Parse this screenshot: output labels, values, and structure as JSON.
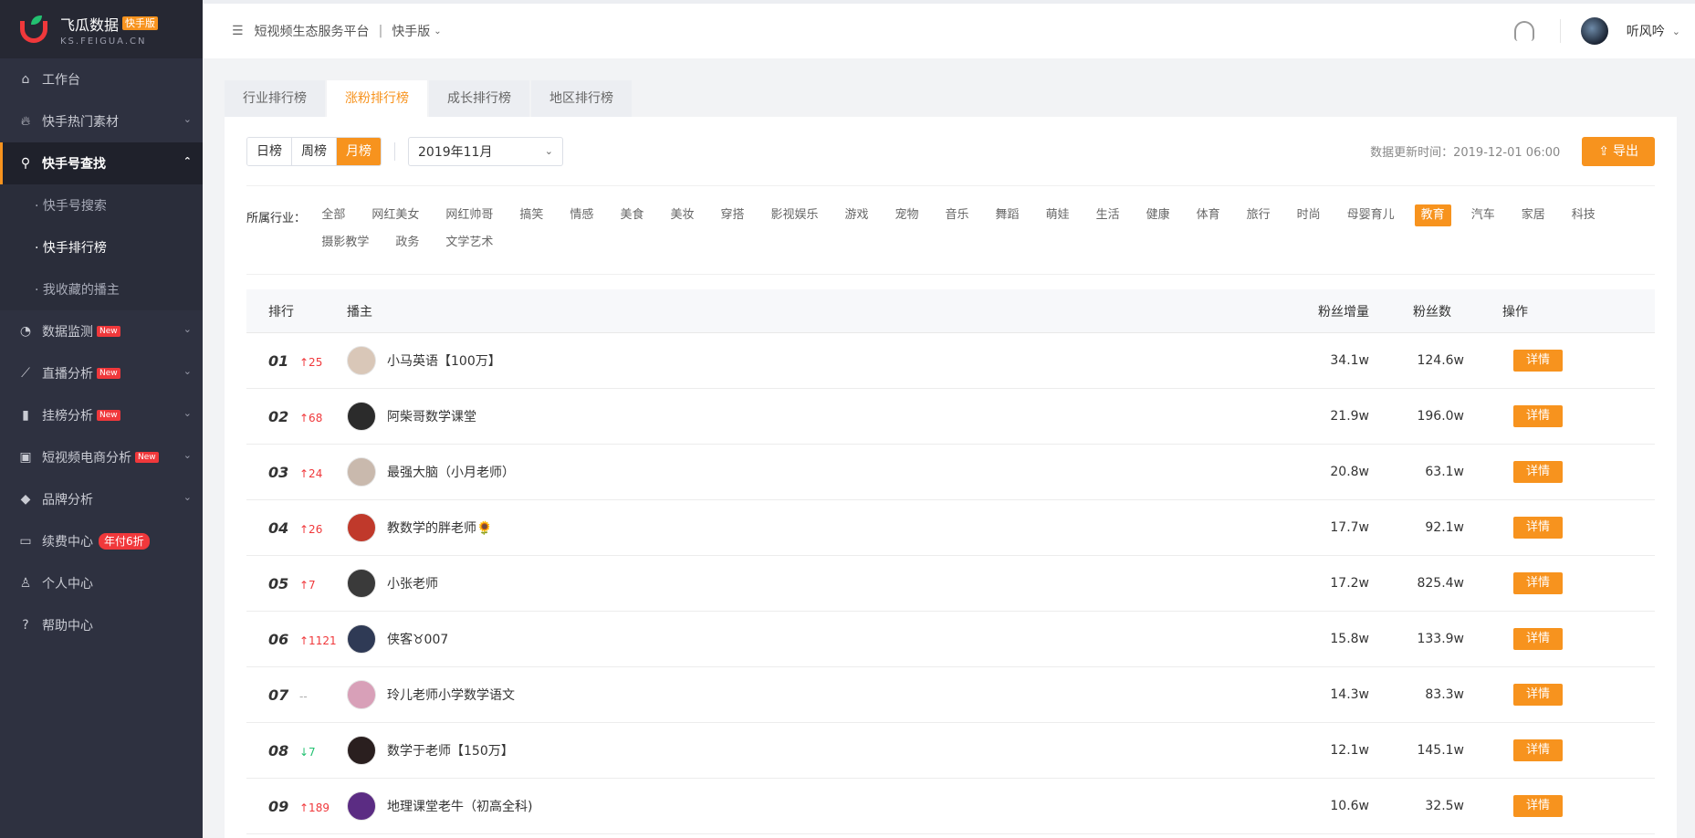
{
  "brand": {
    "title": "飞瓜数据",
    "badge": "快手版",
    "subtitle": "KS.FEIGUA.CN"
  },
  "sidebar": {
    "items": [
      {
        "label": "工作台",
        "icon": "home-icon"
      },
      {
        "label": "快手热门素材",
        "icon": "fire-icon"
      },
      {
        "label": "快手号查找",
        "icon": "search-icon"
      },
      {
        "label": "数据监测",
        "icon": "monitor-icon",
        "badge": "New"
      },
      {
        "label": "直播分析",
        "icon": "trend-icon",
        "badge": "New"
      },
      {
        "label": "挂榜分析",
        "icon": "bar-icon",
        "badge": "New"
      },
      {
        "label": "短视频电商分析",
        "icon": "bag-icon",
        "badge": "New"
      },
      {
        "label": "品牌分析",
        "icon": "diamond-icon"
      },
      {
        "label": "续费中心",
        "icon": "card-icon",
        "promo": "年付6折"
      },
      {
        "label": "个人中心",
        "icon": "user-icon"
      },
      {
        "label": "帮助中心",
        "icon": "help-icon"
      }
    ],
    "sub_items": [
      {
        "label": "· 快手号搜索"
      },
      {
        "label": "· 快手排行榜"
      },
      {
        "label": "· 我收藏的播主"
      }
    ]
  },
  "topbar": {
    "platform": "短视频生态服务平台",
    "separator": "|",
    "edition": "快手版",
    "username": "听风吟"
  },
  "tabs": [
    "行业排行榜",
    "涨粉排行榜",
    "成长排行榜",
    "地区排行榜"
  ],
  "toolbar": {
    "periods": [
      "日榜",
      "周榜",
      "月榜"
    ],
    "month": "2019年11月",
    "update_time": "数据更新时间：2019-12-01 06:00",
    "export_label": "导出"
  },
  "filters": {
    "label": "所属行业：",
    "items": [
      "全部",
      "网红美女",
      "网红帅哥",
      "搞笑",
      "情感",
      "美食",
      "美妆",
      "穿搭",
      "影视娱乐",
      "游戏",
      "宠物",
      "音乐",
      "舞蹈",
      "萌娃",
      "生活",
      "健康",
      "体育",
      "旅行",
      "时尚",
      "母婴育儿",
      "教育",
      "汽车",
      "家居",
      "科技",
      "摄影教学",
      "政务",
      "文学艺术"
    ],
    "active": "教育"
  },
  "table": {
    "headers": {
      "rank": "排行",
      "anchor": "播主",
      "increase": "粉丝增量",
      "fans": "粉丝数",
      "op": "操作"
    },
    "detail_label": "详情",
    "rows": [
      {
        "rank": "01",
        "change": "↑25",
        "dir": "up",
        "name": "小马英语【100万】",
        "increase": "34.1w",
        "fans": "124.6w",
        "avatar_color": "#d9c7b8"
      },
      {
        "rank": "02",
        "change": "↑68",
        "dir": "up",
        "name": "阿柴哥数学课堂",
        "increase": "21.9w",
        "fans": "196.0w",
        "avatar_color": "#2b2b2b"
      },
      {
        "rank": "03",
        "change": "↑24",
        "dir": "up",
        "name": "最强大脑（小月老师）",
        "increase": "20.8w",
        "fans": "63.1w",
        "avatar_color": "#c9b9ad"
      },
      {
        "rank": "04",
        "change": "↑26",
        "dir": "up",
        "name": "教数学的胖老师🌻",
        "increase": "17.7w",
        "fans": "92.1w",
        "avatar_color": "#c0392b"
      },
      {
        "rank": "05",
        "change": "↑7",
        "dir": "up",
        "name": "小张老师",
        "increase": "17.2w",
        "fans": "825.4w",
        "avatar_color": "#3a3a3a"
      },
      {
        "rank": "06",
        "change": "↑1121",
        "dir": "up",
        "name": "侠客♉007",
        "increase": "15.8w",
        "fans": "133.9w",
        "avatar_color": "#2f3a55"
      },
      {
        "rank": "07",
        "change": "--",
        "dir": "flat",
        "name": "玲儿老师小学数学语文",
        "increase": "14.3w",
        "fans": "83.3w",
        "avatar_color": "#d8a0b8"
      },
      {
        "rank": "08",
        "change": "↓7",
        "dir": "down",
        "name": "数学于老师【150万】",
        "increase": "12.1w",
        "fans": "145.1w",
        "avatar_color": "#2a1f1f"
      },
      {
        "rank": "09",
        "change": "↑189",
        "dir": "up",
        "name": "地理课堂老牛（初高全科)",
        "increase": "10.6w",
        "fans": "32.5w",
        "avatar_color": "#5b2c83"
      }
    ]
  },
  "colors": {
    "accent": "#f7931e",
    "sidebar_bg": "#2e3140",
    "up": "#f0383b",
    "down": "#23c171"
  }
}
